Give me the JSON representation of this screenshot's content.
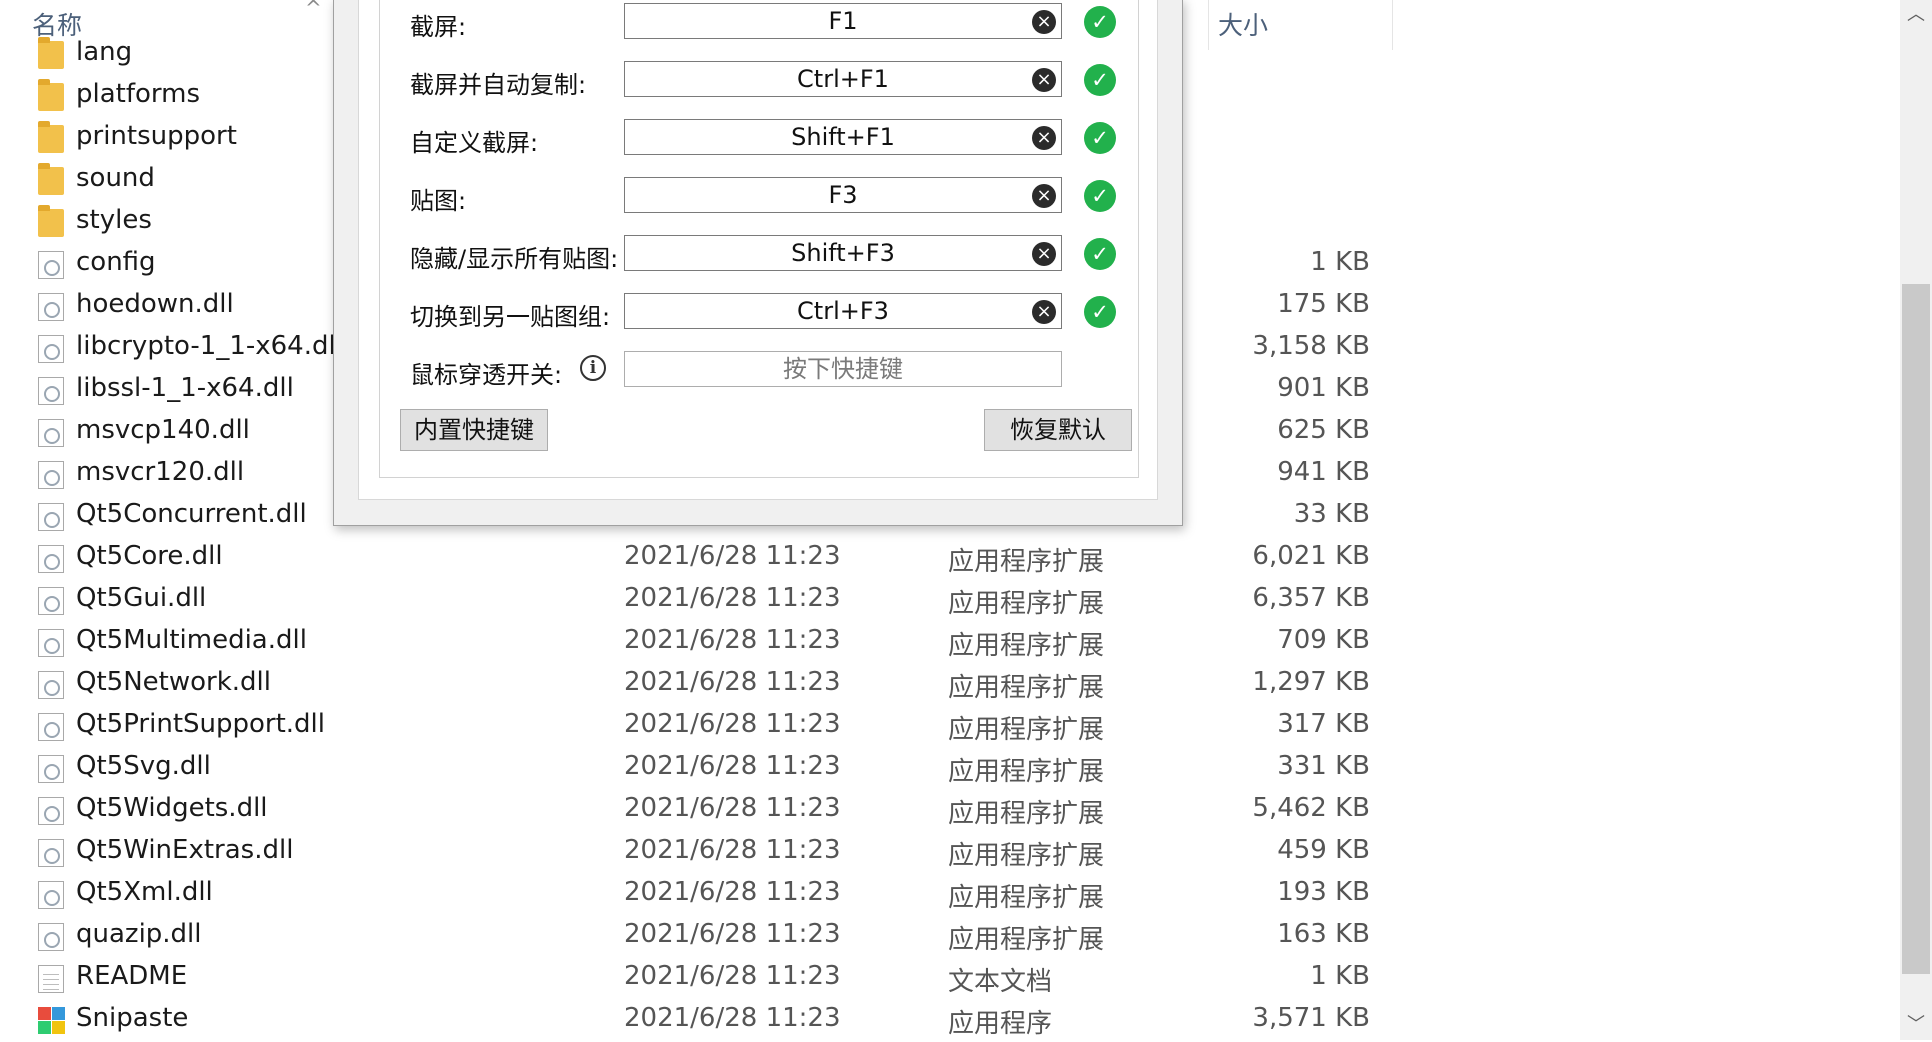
{
  "explorer": {
    "columns": {
      "name": "名称",
      "size": "大小"
    },
    "rows": [
      {
        "name": "lang",
        "date": "",
        "type": "",
        "size": "",
        "icon": "folder-icon"
      },
      {
        "name": "platforms",
        "date": "",
        "type": "",
        "size": "",
        "icon": "folder-icon"
      },
      {
        "name": "printsupport",
        "date": "",
        "type": "",
        "size": "",
        "icon": "folder-icon"
      },
      {
        "name": "sound",
        "date": "",
        "type": "",
        "size": "",
        "icon": "folder-icon"
      },
      {
        "name": "styles",
        "date": "",
        "type": "",
        "size": "",
        "icon": "folder-icon"
      },
      {
        "name": "config",
        "date": "",
        "type": "",
        "size": "1 KB",
        "icon": "config-file-icon"
      },
      {
        "name": "hoedown.dll",
        "date": "",
        "type": "",
        "size": "175 KB",
        "icon": "dll-file-icon"
      },
      {
        "name": "libcrypto-1_1-x64.dll",
        "date": "",
        "type": "",
        "size": "3,158 KB",
        "icon": "dll-file-icon"
      },
      {
        "name": "libssl-1_1-x64.dll",
        "date": "",
        "type": "",
        "size": "901 KB",
        "icon": "dll-file-icon"
      },
      {
        "name": "msvcp140.dll",
        "date": "",
        "type": "",
        "size": "625 KB",
        "icon": "dll-file-icon"
      },
      {
        "name": "msvcr120.dll",
        "date": "",
        "type": "",
        "size": "941 KB",
        "icon": "dll-file-icon"
      },
      {
        "name": "Qt5Concurrent.dll",
        "date": "",
        "type": "",
        "size": "33 KB",
        "icon": "dll-file-icon"
      },
      {
        "name": "Qt5Core.dll",
        "date": "2021/6/28 11:23",
        "type": "应用程序扩展",
        "size": "6,021 KB",
        "icon": "dll-file-icon"
      },
      {
        "name": "Qt5Gui.dll",
        "date": "2021/6/28 11:23",
        "type": "应用程序扩展",
        "size": "6,357 KB",
        "icon": "dll-file-icon"
      },
      {
        "name": "Qt5Multimedia.dll",
        "date": "2021/6/28 11:23",
        "type": "应用程序扩展",
        "size": "709 KB",
        "icon": "dll-file-icon"
      },
      {
        "name": "Qt5Network.dll",
        "date": "2021/6/28 11:23",
        "type": "应用程序扩展",
        "size": "1,297 KB",
        "icon": "dll-file-icon"
      },
      {
        "name": "Qt5PrintSupport.dll",
        "date": "2021/6/28 11:23",
        "type": "应用程序扩展",
        "size": "317 KB",
        "icon": "dll-file-icon"
      },
      {
        "name": "Qt5Svg.dll",
        "date": "2021/6/28 11:23",
        "type": "应用程序扩展",
        "size": "331 KB",
        "icon": "dll-file-icon"
      },
      {
        "name": "Qt5Widgets.dll",
        "date": "2021/6/28 11:23",
        "type": "应用程序扩展",
        "size": "5,462 KB",
        "icon": "dll-file-icon"
      },
      {
        "name": "Qt5WinExtras.dll",
        "date": "2021/6/28 11:23",
        "type": "应用程序扩展",
        "size": "459 KB",
        "icon": "dll-file-icon"
      },
      {
        "name": "Qt5Xml.dll",
        "date": "2021/6/28 11:23",
        "type": "应用程序扩展",
        "size": "193 KB",
        "icon": "dll-file-icon"
      },
      {
        "name": "quazip.dll",
        "date": "2021/6/28 11:23",
        "type": "应用程序扩展",
        "size": "163 KB",
        "icon": "dll-file-icon"
      },
      {
        "name": "README",
        "date": "2021/6/28 11:23",
        "type": "文本文档",
        "size": "1 KB",
        "icon": "text-file-icon"
      },
      {
        "name": "Snipaste",
        "date": "2021/6/28 11:23",
        "type": "应用程序",
        "size": "3,571 KB",
        "icon": "snipaste-app-icon"
      }
    ]
  },
  "dialog": {
    "shortcuts": [
      {
        "label": "截屏:",
        "value": "F1",
        "status": "ok"
      },
      {
        "label": "截屏并自动复制:",
        "value": "Ctrl+F1",
        "status": "ok"
      },
      {
        "label": "自定义截屏:",
        "value": "Shift+F1",
        "status": "ok"
      },
      {
        "label": "贴图:",
        "value": "F3",
        "status": "ok"
      },
      {
        "label": "隐藏/显示所有贴图:",
        "value": "Shift+F3",
        "status": "ok"
      },
      {
        "label": "切换到另一贴图组:",
        "value": "Ctrl+F3",
        "status": "ok"
      }
    ],
    "mouse_through": {
      "label": "鼠标穿透开关:",
      "placeholder": "按下快捷键"
    },
    "builtin_button": "内置快捷键",
    "restore_button": "恢复默认",
    "clear_glyph": "×",
    "ok_glyph": "✓",
    "info_glyph": "i"
  },
  "scrollbar": {
    "up_glyph": "︿",
    "down_glyph": "﹀"
  },
  "colors": {
    "ok_green": "#22b14c",
    "folder_yellow": "#f2c14b"
  }
}
